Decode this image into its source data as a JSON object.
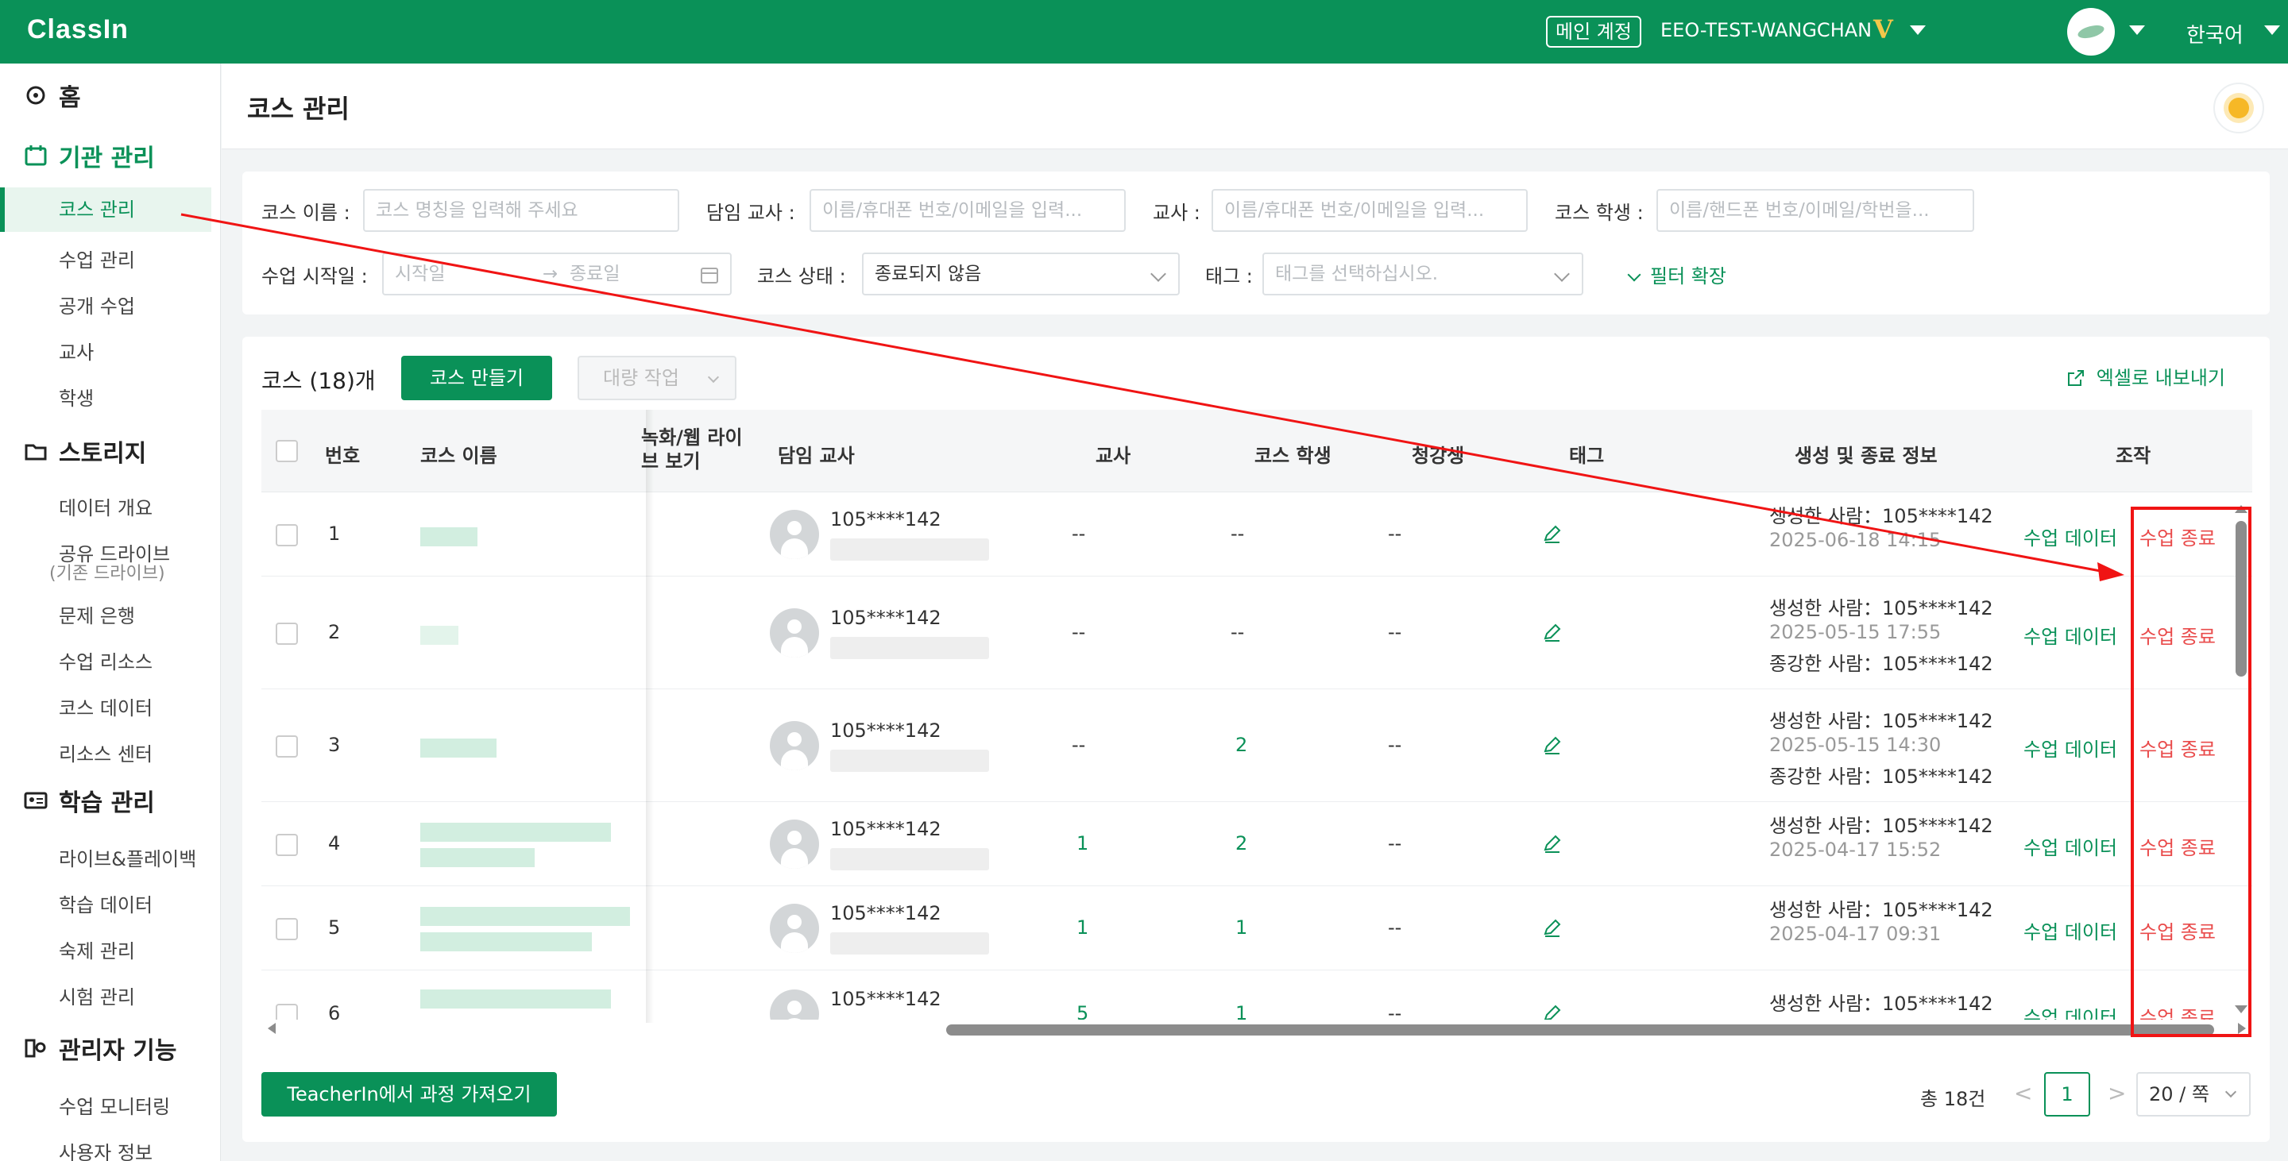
{
  "topbar": {
    "logo": "ClassIn",
    "main_account": "메인 계정",
    "account_name": "EEO-TEST-WANGCHAN",
    "vip_badge": "V",
    "language": "한국어"
  },
  "sidebar": {
    "home": "홈",
    "org_section": "기관 관리",
    "org_items": [
      "코스 관리",
      "수업 관리",
      "공개 수업",
      "교사",
      "학생"
    ],
    "storage_section": "스토리지",
    "storage_items": [
      "데이터 개요",
      "공유 드라이브",
      "문제 은행",
      "수업 리소스",
      "코스 데이터",
      "리소스 센터"
    ],
    "storage_sub": "(기존 드라이브)",
    "learning_section": "학습 관리",
    "learning_items": [
      "라이브&플레이백",
      "학습 데이터",
      "숙제 관리",
      "시험 관리"
    ],
    "admin_section": "관리자 기능",
    "admin_items": [
      "수업 모니터링",
      "사용자 정보"
    ]
  },
  "header": {
    "title": "코스 관리"
  },
  "filters": {
    "course_name_label": "코스 이름 :",
    "course_name_placeholder": "코스 명칭을 입력해 주세요",
    "head_teacher_label": "담임 교사 :",
    "head_teacher_placeholder": "이름/휴대폰 번호/이메일을 입력...",
    "teacher_label": "교사 :",
    "teacher_placeholder": "이름/휴대폰 번호/이메일을 입력...",
    "student_label": "코스 학생 :",
    "student_placeholder": "이름/핸드폰 번호/이메일/학번을...",
    "start_date_label": "수업 시작일 :",
    "start_placeholder": "시작일",
    "date_sep": "→",
    "end_placeholder": "종료일",
    "status_label": "코스 상태 :",
    "status_value": "종료되지 않음",
    "tag_label": "태그 :",
    "tag_placeholder": "태그를 선택하십시오.",
    "expand_label": "필터 확장"
  },
  "table": {
    "count_title": "코스 (18)개",
    "create_button": "코스 만들기",
    "bulk_button": "대량 작업",
    "export_button": "엑셀로 내보내기",
    "headers": {
      "no": "번호",
      "name": "코스 이름",
      "replay_line1": "녹화/웹 라이",
      "replay_line2": "브 보기",
      "head_teacher": "담임 교사",
      "teacher": "교사",
      "students": "코스 학생",
      "auditors": "청강생",
      "tag": "태그",
      "info": "생성 및 종료 정보",
      "actions": "조작"
    },
    "rows": [
      {
        "no": "1",
        "teacher_id": "105****142",
        "teacher_count": "--",
        "student_count": "--",
        "auditors": "--",
        "created_by": "생성한 사람：105****142",
        "created_at": "2025-06-18 14:15",
        "ended_by": "",
        "data_link": "수업 데이터",
        "end_link": "수업 종료"
      },
      {
        "no": "2",
        "teacher_id": "105****142",
        "teacher_count": "--",
        "student_count": "--",
        "auditors": "--",
        "created_by": "생성한 사람：105****142",
        "created_at": "2025-05-15 17:55",
        "ended_by": "종강한 사람：105****142",
        "data_link": "수업 데이터",
        "end_link": "수업 종료"
      },
      {
        "no": "3",
        "teacher_id": "105****142",
        "teacher_count": "--",
        "student_count": "2",
        "auditors": "--",
        "created_by": "생성한 사람：105****142",
        "created_at": "2025-05-15 14:30",
        "ended_by": "종강한 사람：105****142",
        "data_link": "수업 데이터",
        "end_link": "수업 종료"
      },
      {
        "no": "4",
        "teacher_id": "105****142",
        "teacher_count": "1",
        "student_count": "2",
        "auditors": "--",
        "created_by": "생성한 사람：105****142",
        "created_at": "2025-04-17 15:52",
        "ended_by": "",
        "data_link": "수업 데이터",
        "end_link": "수업 종료"
      },
      {
        "no": "5",
        "teacher_id": "105****142",
        "teacher_count": "1",
        "student_count": "1",
        "auditors": "--",
        "created_by": "생성한 사람：105****142",
        "created_at": "2025-04-17 09:31",
        "ended_by": "",
        "data_link": "수업 데이터",
        "end_link": "수업 종료"
      },
      {
        "no": "6",
        "teacher_id": "105****142",
        "teacher_count": "5",
        "student_count": "1",
        "auditors": "--",
        "created_by": "생성한 사람：105****142",
        "created_at": "",
        "ended_by": "",
        "data_link": "수업 데이터",
        "end_link": "수업 종료"
      }
    ],
    "import_button": "TeacherIn에서 과정 가져오기"
  },
  "pagination": {
    "total": "총 18건",
    "prev": "<",
    "current": "1",
    "next": ">",
    "page_size": "20 / 쪽"
  },
  "colors": {
    "brand": "#0a9158",
    "danger": "#e94b4b",
    "highlight": "#f01414"
  }
}
